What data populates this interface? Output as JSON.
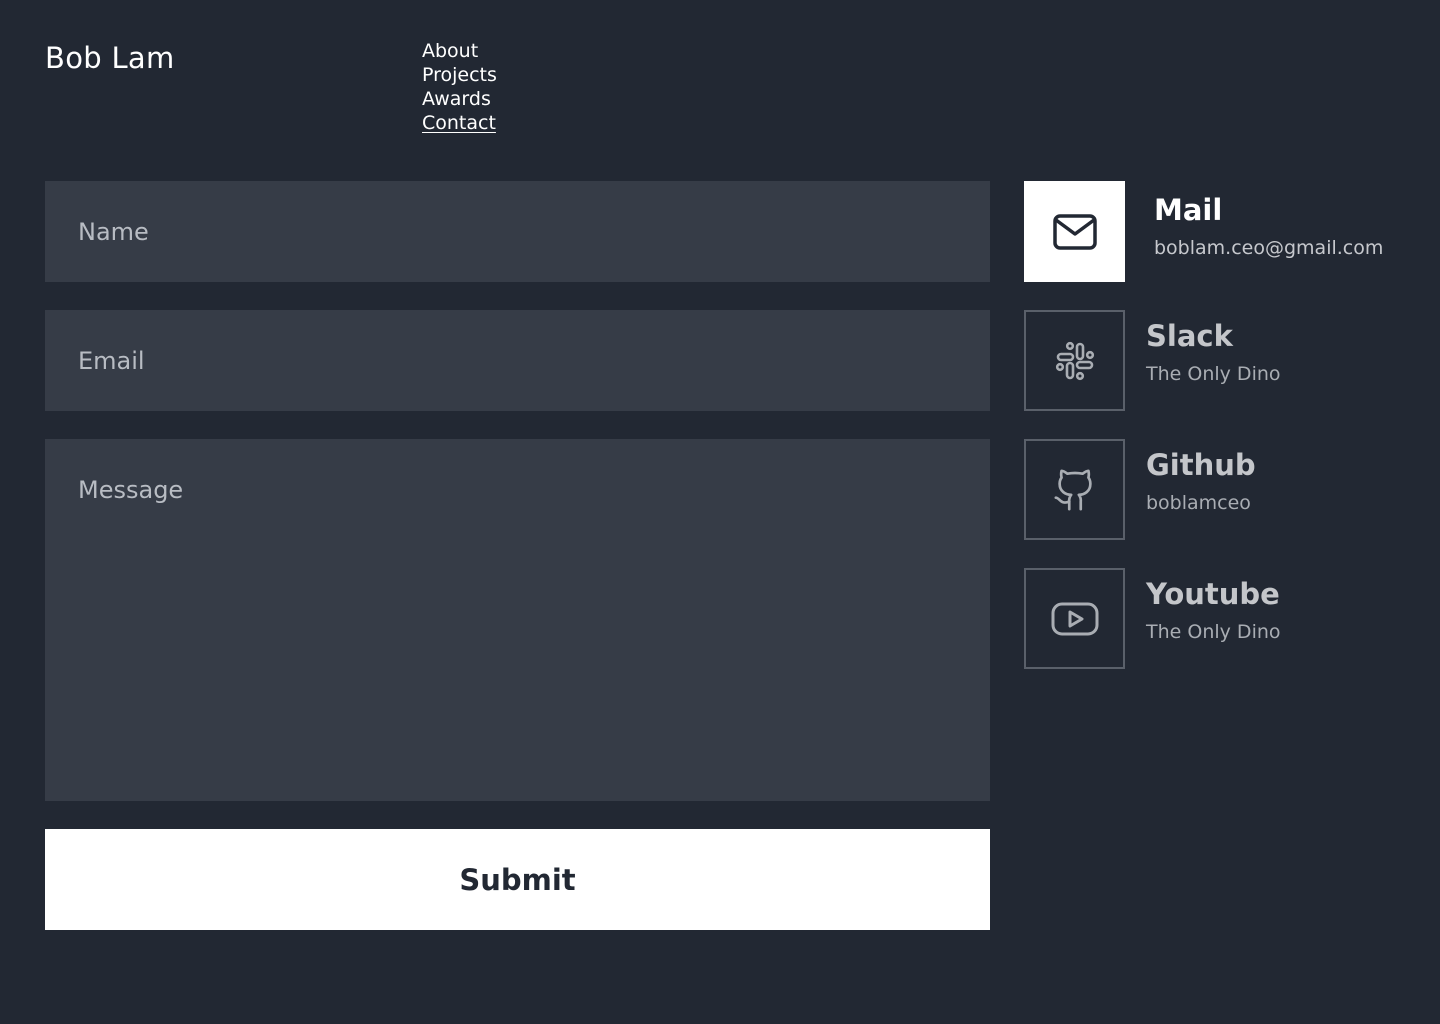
{
  "header": {
    "brand": "Bob Lam",
    "nav": [
      {
        "label": "About"
      },
      {
        "label": "Projects"
      },
      {
        "label": "Awards"
      },
      {
        "label": "Contact"
      }
    ]
  },
  "form": {
    "name_placeholder": "Name",
    "email_placeholder": "Email",
    "message_placeholder": "Message",
    "submit_label": "Submit"
  },
  "contacts": [
    {
      "title": "Mail",
      "detail": "boblam.ceo@gmail.com",
      "icon": "mail-icon"
    },
    {
      "title": "Slack",
      "detail": "The Only Dino",
      "icon": "slack-icon"
    },
    {
      "title": "Github",
      "detail": "boblamceo",
      "icon": "github-icon"
    },
    {
      "title": "Youtube",
      "detail": "The Only Dino",
      "icon": "youtube-icon"
    }
  ],
  "colors": {
    "background": "#222833",
    "field": "#363c47",
    "accent": "#ffffff",
    "muted_border": "#5a606a"
  }
}
